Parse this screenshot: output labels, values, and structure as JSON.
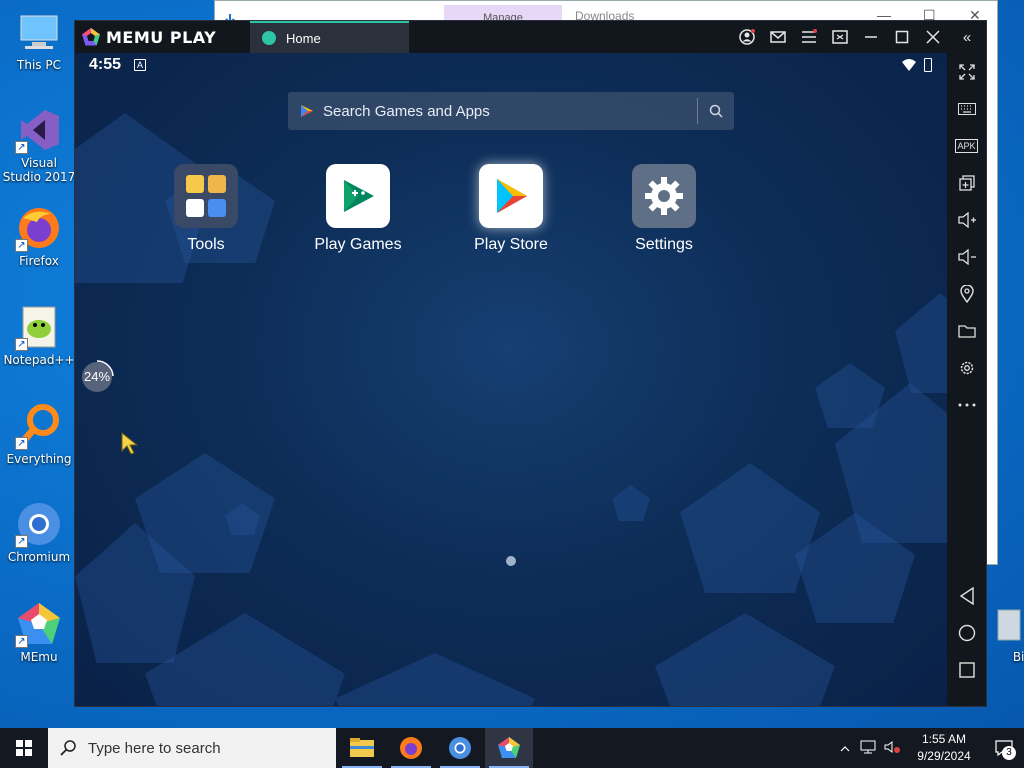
{
  "desktop": {
    "icons": [
      {
        "label": "This PC",
        "icon": "this-pc-icon"
      },
      {
        "label": "Visual Studio 2017",
        "icon": "visual-studio-icon"
      },
      {
        "label": "Firefox",
        "icon": "firefox-icon"
      },
      {
        "label": "Notepad++",
        "icon": "notepad-plus-plus-icon"
      },
      {
        "label": "Everything",
        "icon": "everything-search-icon"
      },
      {
        "label": "Chromium",
        "icon": "chromium-icon"
      },
      {
        "label": "MEmu",
        "icon": "memu-icon"
      }
    ],
    "recycle_bin_partial": "Bin"
  },
  "explorer": {
    "manage_label": "Manage",
    "downloads_label": "Downloads"
  },
  "memu": {
    "brand": "MEMU PLAY",
    "tab_label": "Home",
    "title_buttons": [
      "account-icon",
      "mail-icon",
      "menu-icon",
      "screen-icon",
      "minimize-icon",
      "maximize-icon",
      "close-icon"
    ],
    "collapse_label": "«",
    "status": {
      "time": "4:55"
    },
    "search_placeholder": "Search Games and Apps",
    "apps": [
      {
        "label": "Tools"
      },
      {
        "label": "Play Games"
      },
      {
        "label": "Play Store"
      },
      {
        "label": "Settings"
      }
    ],
    "progress_label": "24%",
    "progress_value": 0.24,
    "sidebar": {
      "apk_label": "APK",
      "tools": [
        "fullscreen-icon",
        "keyboard-icon",
        "apk-icon",
        "multi-instance-icon",
        "volume-up-icon",
        "volume-down-icon",
        "location-icon",
        "folder-icon",
        "settings-icon",
        "more-icon"
      ],
      "nav": [
        "back-icon",
        "home-icon",
        "recents-icon"
      ]
    }
  },
  "taskbar": {
    "search_placeholder": "Type here to search",
    "apps": [
      "file-explorer-icon",
      "firefox-icon",
      "chromium-icon",
      "memu-icon"
    ],
    "time": "1:55 AM",
    "date": "9/29/2024",
    "notification_count": "3"
  },
  "colors": {
    "accent": "#2ec4a6",
    "screen_bg": "#0d2d57",
    "taskbar": "#141820",
    "desktop": "#0a6cc7"
  }
}
